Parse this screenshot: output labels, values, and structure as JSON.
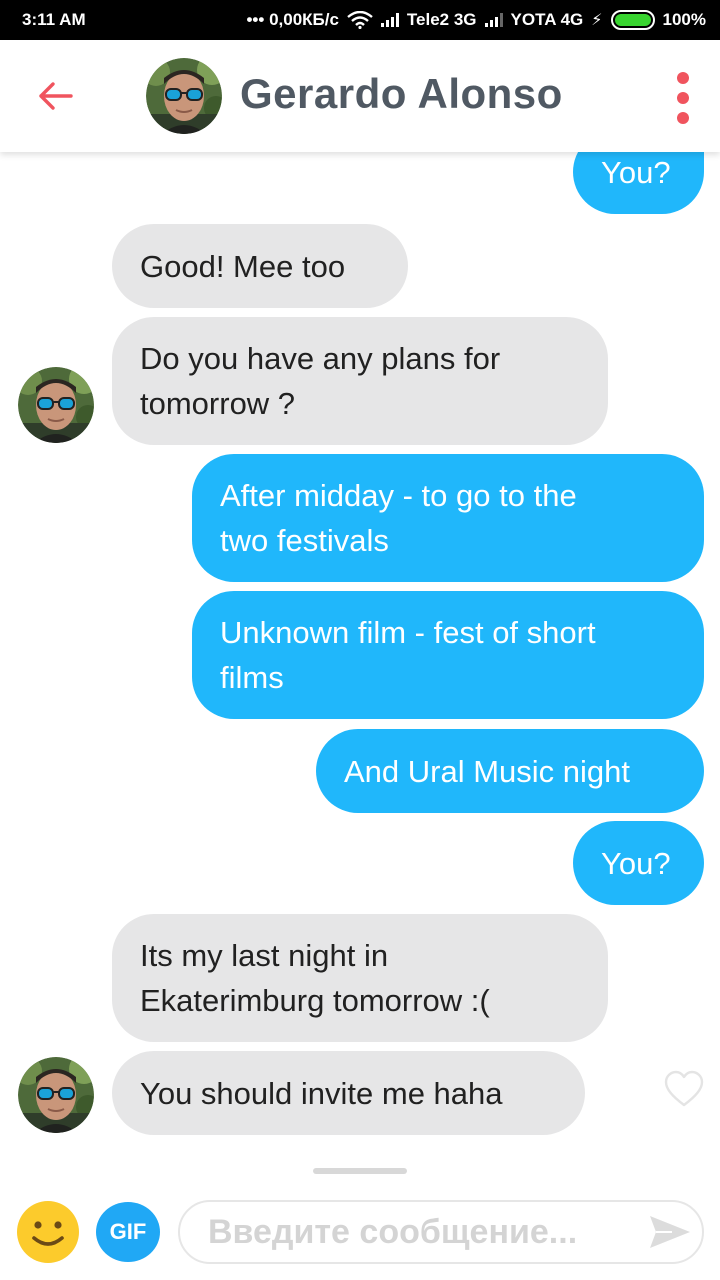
{
  "status_bar": {
    "time": "3:11 AM",
    "network_speed": "••• 0,00КБ/c",
    "carrier1": "Tele2 3G",
    "carrier2": "YOTA 4G",
    "battery_level": 1.0,
    "battery_text": "100%",
    "battery_color": "#39d430"
  },
  "header": {
    "contact_name": "Gerardo Alonso",
    "back_icon": "arrow-left-icon",
    "menu_icon": "vertical-dots-icon",
    "accent_color": "#f0545e"
  },
  "messages": [
    {
      "direction": "out",
      "text": "You?"
    },
    {
      "direction": "in",
      "text": "Good! Mee too"
    },
    {
      "direction": "in",
      "lines": [
        "Do you have any plans for",
        "tomorrow ?"
      ]
    },
    {
      "direction": "out",
      "lines": [
        "After midday - to go to the",
        "two festivals"
      ]
    },
    {
      "direction": "out",
      "lines": [
        "Unknown film - fest of short",
        "films"
      ]
    },
    {
      "direction": "out",
      "text": "And Ural Music night"
    },
    {
      "direction": "out",
      "text": "You?"
    },
    {
      "direction": "in",
      "lines": [
        "Its my last night in",
        "Ekaterimburg tomorrow :("
      ]
    },
    {
      "direction": "in",
      "text": "You should invite me haha"
    }
  ],
  "colors": {
    "outgoing_bubble": "#20b7fb",
    "incoming_bubble": "#e6e6e7"
  },
  "composer": {
    "emoji_icon": "smiley-icon",
    "gif_label": "GIF",
    "placeholder": "Введите сообщение...",
    "value": "",
    "send_icon": "send-arrow-icon"
  }
}
